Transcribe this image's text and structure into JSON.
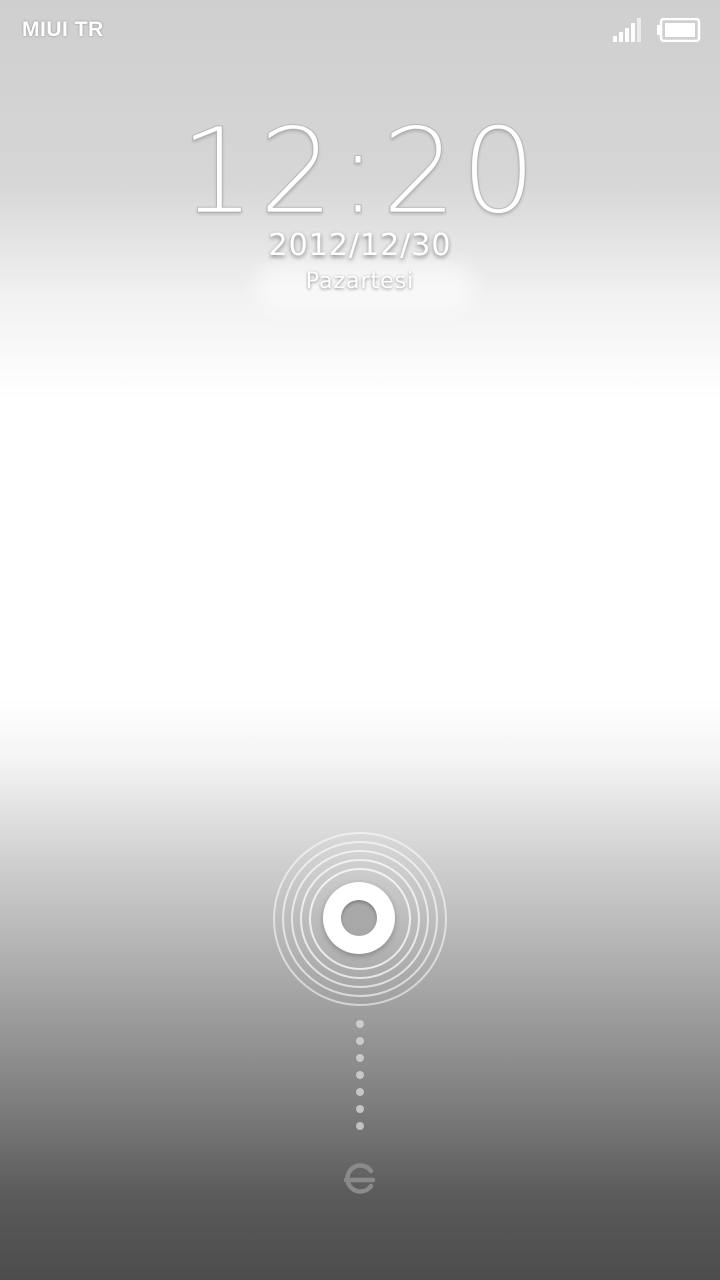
{
  "status_bar": {
    "carrier": "MIUI TR",
    "signal_icon": "signal-icon",
    "battery_icon": "battery-icon"
  },
  "lockscreen": {
    "time": "12:20",
    "date": "2012/12/30",
    "weekday": "Pazartesi"
  },
  "unlock": {
    "handle_icon": "unlock-handle-icon",
    "target_icon": "unlock-target-icon"
  },
  "colors": {
    "text": "#ffffff",
    "dot": "#dcdcdc",
    "target": "#8a8a8a"
  }
}
